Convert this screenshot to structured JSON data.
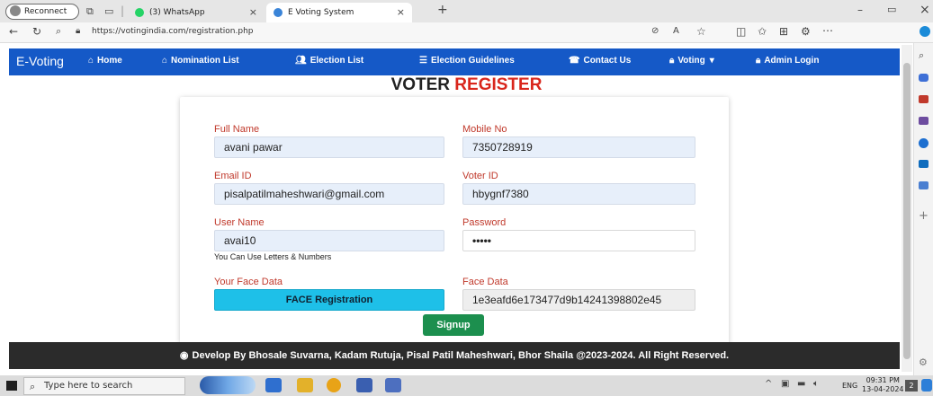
{
  "browser": {
    "reconnect_label": "Reconnect",
    "tabs": [
      {
        "label": "(3) WhatsApp"
      },
      {
        "label": "E Voting System"
      }
    ],
    "url": "https://votingindia.com/registration.php"
  },
  "navbar": {
    "brand": "E-Voting",
    "items": [
      {
        "label": "Home"
      },
      {
        "label": "Nomination List"
      },
      {
        "label": "Election List"
      },
      {
        "label": "Election Guidelines"
      },
      {
        "label": "Contact Us"
      },
      {
        "label": "Voting"
      },
      {
        "label": "Admin Login"
      }
    ]
  },
  "form": {
    "title_main": "VOTER",
    "title_accent": "REGISTER",
    "full_name_label": "Full Name",
    "full_name_value": "avani pawar",
    "mobile_label": "Mobile No",
    "mobile_value": "7350728919",
    "email_label": "Email ID",
    "email_value": "pisalpatilmaheshwari@gmail.com",
    "voter_id_label": "Voter ID",
    "voter_id_value": "hbygnf7380",
    "username_label": "User Name",
    "username_value": "avai10",
    "username_hint": "You Can Use Letters & Numbers",
    "password_label": "Password",
    "password_value": "•••••",
    "face_label": "Your Face Data",
    "face_button": "FACE Registration",
    "face_data_label": "Face Data",
    "face_data_value": "1e3eafd6e173477d9b14241398802e45",
    "signup_button": "Signup"
  },
  "footer": {
    "text": "Develop By Bhosale Suvarna, Kadam Rutuja, Pisal Patil Maheshwari, Bhor Shaila @2023-2024. All Right Reserved."
  },
  "taskbar": {
    "search_placeholder": "Type here to search",
    "language": "ENG",
    "time": "09:31 PM",
    "date": "13-04-2024",
    "notification_count": "2"
  },
  "colors": {
    "navbar": "#1559c7",
    "accent_red": "#d9261c",
    "face_button": "#1ec0e8",
    "signup_button": "#1c8f4e",
    "footer": "#2b2b2b"
  },
  "icons": [
    "person-icon",
    "tab-actions-icon",
    "whatsapp-icon",
    "edge-icon",
    "back-icon",
    "refresh-icon",
    "search-icon",
    "lock-icon",
    "home-icon",
    "list-icon",
    "users-icon",
    "phone-icon",
    "admin-lock-icon",
    "globe-icon",
    "windows-icon"
  ]
}
